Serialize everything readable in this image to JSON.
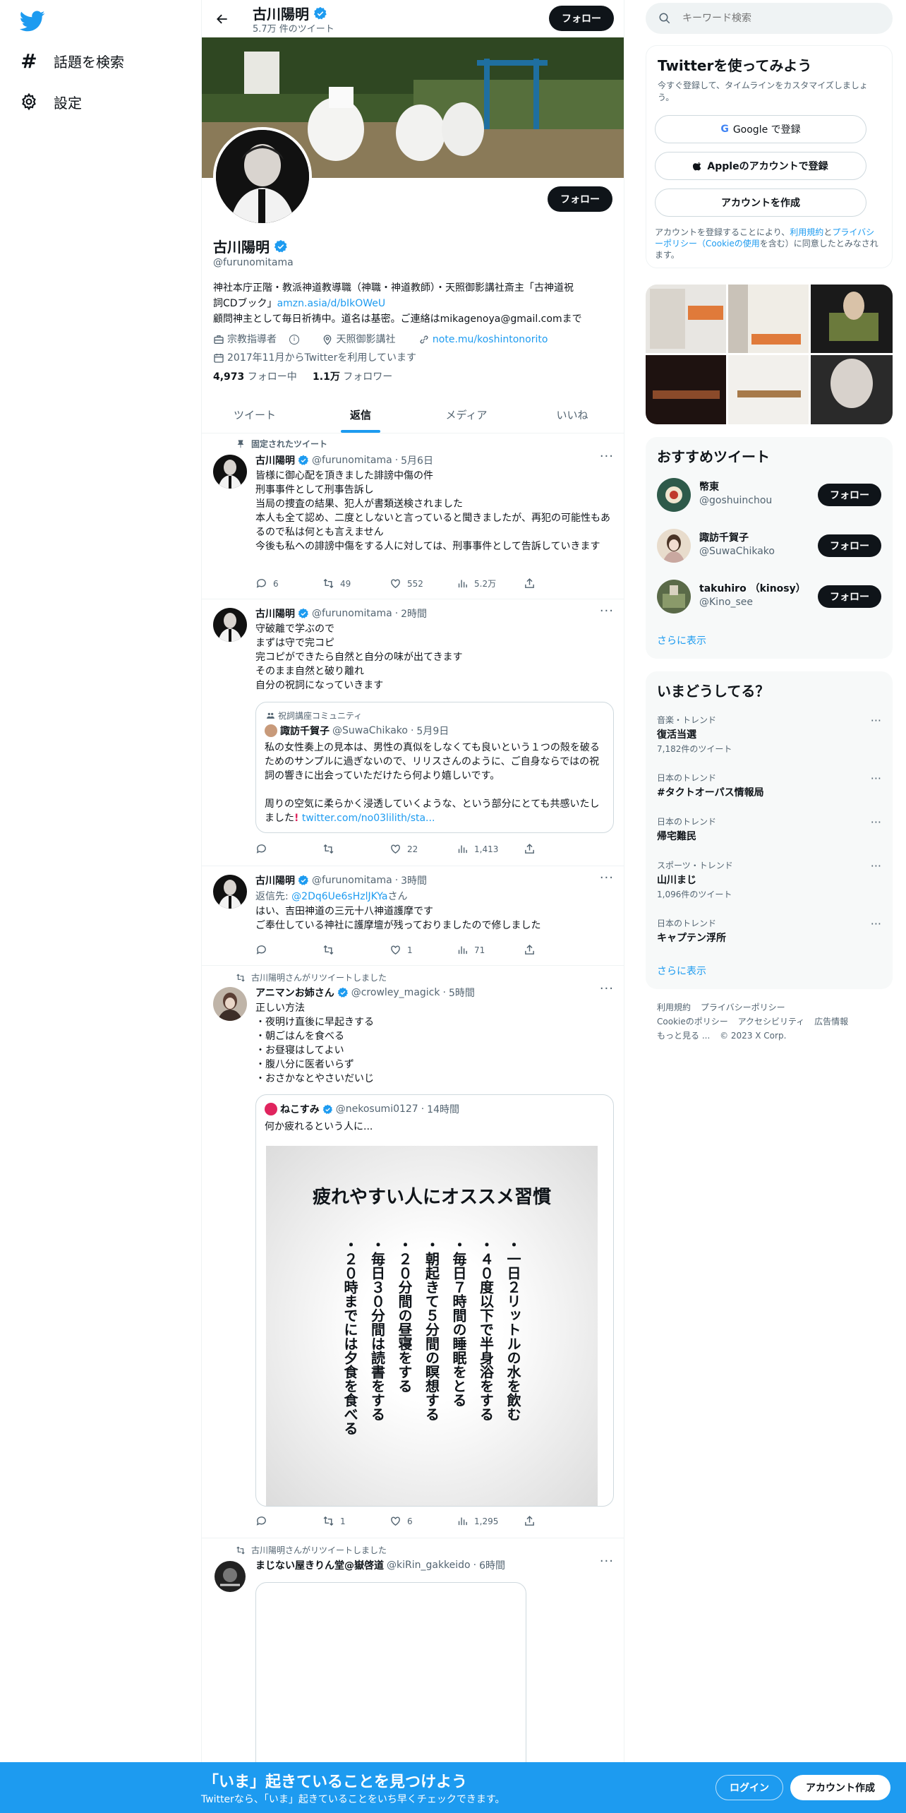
{
  "nav": {
    "explore": "話題を検索",
    "settings": "設定"
  },
  "header": {
    "name": "古川陽明",
    "tweet_count": "5.7万 件のツイート",
    "follow": "フォロー"
  },
  "profile": {
    "name": "古川陽明",
    "handle": "@furunomitama",
    "follow": "フォロー",
    "bio_line1": "神社本庁正階・教派神道教導職（神職・神道教師）・天照御影講社斎主「古神道祝",
    "bio_line2a": "詞CDブック」",
    "bio_link": "amzn.asia/d/bIkOWeU",
    "bio_line3": "顧問神主として毎日祈祷中。道名は基密。ご連絡はmikagenoya@gmail.comまで",
    "category": "宗教指導者",
    "location": "天照御影講社",
    "url": "note.mu/koshintonorito",
    "joined": "2017年11月からTwitterを利用しています",
    "following_count": "4,973",
    "following_label": "フォロー中",
    "followers_count": "1.1万",
    "followers_label": "フォロワー"
  },
  "tabs": [
    "ツイート",
    "返信",
    "メディア",
    "いいね"
  ],
  "tweets": [
    {
      "pinned": "固定されたツイート",
      "name": "古川陽明",
      "handle": "@furunomitama",
      "time": "5月6日",
      "text": "皆様に御心配を頂きました誹謗中傷の件\n刑事事件として刑事告訴し\n当局の捜査の結果、犯人が書類送検されました\n本人も全て認め、二度としないと言っていると聞きましたが、再犯の可能性もあるので私は何とも言えません\n今後も私への誹謗中傷をする人に対しては、刑事事件として告訴していきます",
      "replies": "6",
      "retweets": "49",
      "likes": "552",
      "views": "5.2万"
    },
    {
      "name": "古川陽明",
      "handle": "@furunomitama",
      "time": "2時間",
      "text": "守破離で学ぶので\nまずは守で完コピ\n完コピができたら自然と自分の味が出てきます\nそのまま自然と破り離れ\n自分の祝詞になっていきます",
      "quote": {
        "community": "祝詞講座コミュニティ",
        "name": "諏訪千賀子",
        "handle": "@SuwaChikako",
        "time": "5月9日",
        "text": "私の女性奏上の見本は、男性の真似をしなくても良いという１つの殻を破るためのサンプルに過ぎないので、リリスさんのように、ご自身ならではの祝詞の響きに出会っていただけたら何より嬉しいです。\n\n周りの空気に柔らかく浸透していくような、という部分にとても共感いたしました",
        "link": "twitter.com/no03lilith/sta..."
      },
      "replies": "",
      "retweets": "",
      "likes": "22",
      "views": "1,413"
    },
    {
      "name": "古川陽明",
      "handle": "@furunomitama",
      "time": "3時間",
      "reply_to_label": "返信先: ",
      "reply_to": "@2Dq6Ue6sHzlJKYa",
      "reply_to_suffix": "さん",
      "text": "はい、吉田神道の三元十八神道護摩です\nご奉仕している神社に護摩壇が残っておりましたので修しました",
      "replies": "",
      "retweets": "",
      "likes": "1",
      "views": "71"
    },
    {
      "retweeted_by": "古川陽明さんがリツイートしました",
      "name": "アニマンお姉さん",
      "handle": "@crowley_magick",
      "time": "5時間",
      "text": "正しい方法\n・夜明け直後に早起きする\n・朝ごはんを食べる\n・お昼寝はしてよい\n・腹八分に医者いらず\n・おさかなとやさいだいじ",
      "quote": {
        "name": "ねこすみ",
        "handle": "@nekosumi0127",
        "time": "14時間",
        "text": "何か疲れるという人に...",
        "image_title": "疲れやすい人にオススメ習慣",
        "image_items": [
          "・一日２リットルの水を飲む",
          "・４０度以下で半身浴をする",
          "・毎日７時間の睡眠をとる",
          "・朝起きて５分間の瞑想する",
          "・２０分間の昼寝をする",
          "・毎日３０分間は読書をする",
          "・２０時までには夕食を食べる"
        ]
      },
      "replies": "",
      "retweets": "1",
      "likes": "6",
      "views": "1,295"
    },
    {
      "retweeted_by": "古川陽明さんがリツイートしました",
      "name": "まじない屋きりん堂@嶽啓道",
      "handle": "@kiRin_gakkeido",
      "time": "6時間"
    }
  ],
  "search": {
    "placeholder": "キーワード検索"
  },
  "signup": {
    "title": "Twitterを使ってみよう",
    "subtitle": "今すぐ登録して、タイムラインをカスタマイズしましょう。",
    "google": "Google で登録",
    "apple": "Appleのアカウントで登録",
    "create": "アカウントを作成",
    "legal_pre": "アカウントを登録することにより、",
    "terms": "利用規約",
    "legal_and": "と",
    "privacy": "プライバシーポリシー（Cookieの使用",
    "legal_post": "を含む）に同意したとみなされます。"
  },
  "recommended": {
    "title": "おすすめツイート",
    "users": [
      {
        "name": "幣東",
        "handle": "@goshuinchou",
        "button": "フォロー"
      },
      {
        "name": "諏訪千賀子",
        "handle": "@SuwaChikako",
        "button": "フォロー"
      },
      {
        "name": "takuhiro （kinosy）",
        "handle": "@Kino_see",
        "button": "フォロー"
      }
    ],
    "more": "さらに表示"
  },
  "trends": {
    "title": "いまどうしてる？",
    "items": [
      {
        "context": "音楽・トレンド",
        "name": "復活当選",
        "count": "7,182件のツイート"
      },
      {
        "context": "日本のトレンド",
        "name": "#タクトオーパス情報局",
        "count": ""
      },
      {
        "context": "日本のトレンド",
        "name": "帰宅難民",
        "count": ""
      },
      {
        "context": "スポーツ・トレンド",
        "name": "山川まじ",
        "count": "1,096件のツイート"
      },
      {
        "context": "日本のトレンド",
        "name": "キャプテン浮所",
        "count": ""
      }
    ],
    "more": "さらに表示"
  },
  "footer": {
    "links": [
      "利用規約",
      "プライバシーポリシー",
      "Cookieのポリシー",
      "アクセシビリティ",
      "広告情報",
      "もっと見る ...",
      "© 2023 X Corp."
    ]
  },
  "bottombar": {
    "title": "「いま」起きていることを見つけよう",
    "subtitle": "Twitterなら、「いま」起きていることをいち早くチェックできます。",
    "login": "ログイン",
    "signup": "アカウント作成"
  },
  "colors": {
    "accent": "#1d9bf0",
    "text": "#0f1419",
    "secondary": "#536471"
  }
}
